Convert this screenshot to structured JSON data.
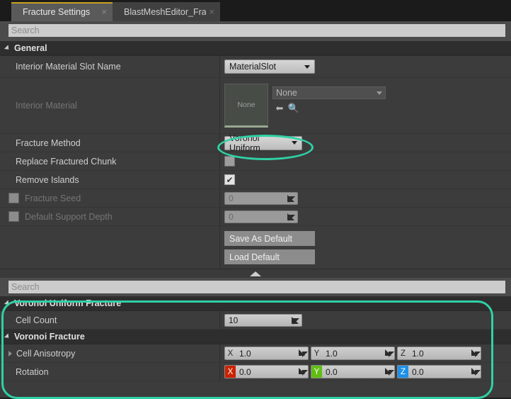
{
  "tabs": [
    {
      "label": "Fracture Settings",
      "close": "×",
      "active": true
    },
    {
      "label": "BlastMeshEditor_Frac",
      "close": "×",
      "active": false
    }
  ],
  "search_top": {
    "placeholder": "Search",
    "value": ""
  },
  "search_bottom": {
    "placeholder": "Search",
    "value": ""
  },
  "general": {
    "title": "General",
    "interior_material_slot_name": {
      "label": "Interior Material Slot Name",
      "value": "MaterialSlot"
    },
    "interior_material": {
      "label": "Interior Material",
      "thumbnail_text": "None",
      "asset_value": "None",
      "browse_icon": "back-arrow-icon",
      "find_icon": "magnifier-icon"
    },
    "fracture_method": {
      "label": "Fracture Method",
      "value": "Voronoi Uniform"
    },
    "replace_fractured_chunk": {
      "label": "Replace Fractured Chunk",
      "checked": false
    },
    "remove_islands": {
      "label": "Remove Islands",
      "checked": true,
      "check_glyph": "✔"
    },
    "fracture_seed": {
      "label": "Fracture Seed",
      "value": "0",
      "checked": false,
      "disabled": true
    },
    "default_support_depth": {
      "label": "Default Support Depth",
      "value": "0",
      "checked": false,
      "disabled": true
    },
    "save_as_default": "Save As Default",
    "load_default": "Load Default"
  },
  "voronoi_uniform_fracture": {
    "title": "Voronoi Uniform Fracture",
    "cell_count": {
      "label": "Cell Count",
      "value": "10"
    }
  },
  "voronoi_fracture": {
    "title": "Voronoi Fracture",
    "cell_anisotropy": {
      "label": "Cell Anisotropy",
      "axes": [
        {
          "tag": "X",
          "value": "1.0",
          "colored": false
        },
        {
          "tag": "Y",
          "value": "1.0",
          "colored": false
        },
        {
          "tag": "Z",
          "value": "1.0",
          "colored": false
        }
      ]
    },
    "rotation": {
      "label": "Rotation",
      "axes": [
        {
          "tag": "X",
          "value": "0.0",
          "colored": true
        },
        {
          "tag": "Y",
          "value": "0.0",
          "colored": true
        },
        {
          "tag": "Z",
          "value": "0.0",
          "colored": true
        }
      ]
    }
  },
  "colors": {
    "accent_tab": "#c8a020",
    "annotation": "#2fd1a5",
    "axis_x": "#cc2200",
    "axis_y": "#62bd14",
    "axis_z": "#1e90e8",
    "panel_bg": "#3c3c3c",
    "header_bg": "#2e2e2e"
  }
}
